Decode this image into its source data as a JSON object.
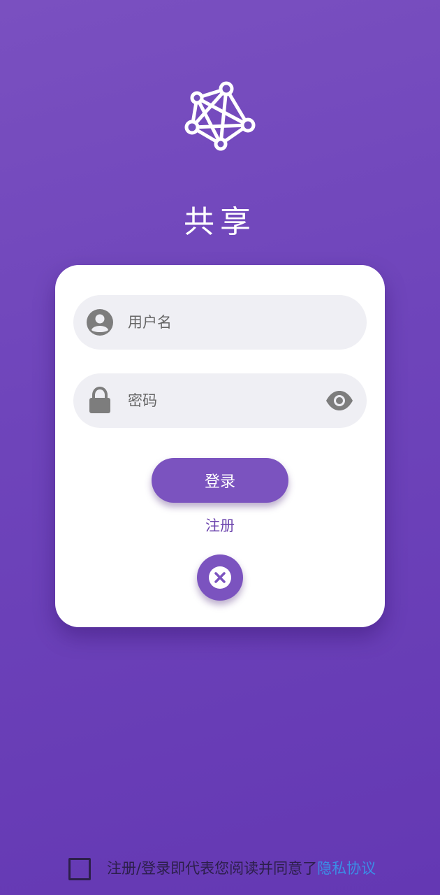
{
  "app": {
    "title": "共享",
    "logo_icon": "network-graph-icon"
  },
  "login_form": {
    "username_placeholder": "用户名",
    "password_placeholder": "密码",
    "login_label": "登录",
    "register_label": "注册",
    "user_icon": "account-circle-icon",
    "lock_icon": "lock-icon",
    "visibility_icon": "eye-icon",
    "close_icon": "close-circle-icon"
  },
  "agreement": {
    "text": "注册/登录即代表您阅读并同意了",
    "link": "隐私协议",
    "checked": false
  },
  "colors": {
    "background_top": "#7a50c0",
    "background_bottom": "#6438b3",
    "accent": "#7b53bf",
    "link": "#3b8de6",
    "field_bg": "#efeff4"
  }
}
